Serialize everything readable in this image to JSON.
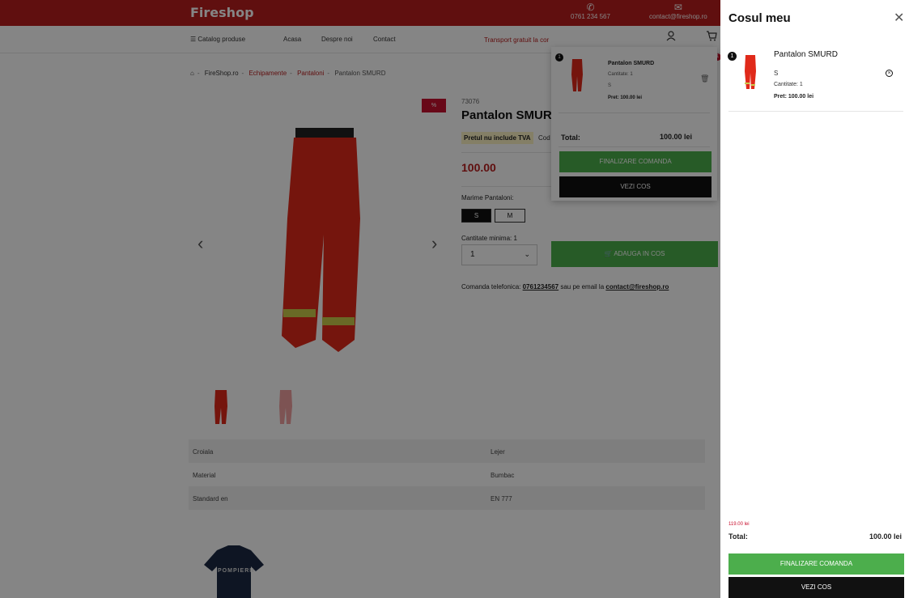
{
  "header": {
    "logo": "Fireshop",
    "phone": "0761 234 567",
    "email": "contact@fireshop.ro",
    "cart_count": "1"
  },
  "nav": {
    "catalog": "Catalog produse",
    "home": "Acasa",
    "about": "Despre noi",
    "contact": "Contact",
    "promo": "Transport gratuit la cor"
  },
  "breadcrumb": {
    "items": [
      "FireShop.ro",
      "Echipamente",
      "Pantaloni",
      "Pantalon SMURD"
    ]
  },
  "product": {
    "sale_badge": "%",
    "sku": "73076",
    "title": "Pantalon SMURD",
    "vat_note": "Pretul nu include TVA",
    "code_label": "Cod",
    "price": "100.00",
    "size_label": "Marime Pantaloni:",
    "sizes": [
      "S",
      "M"
    ],
    "qty_label": "Cantitate minima: 1",
    "qty_value": "1",
    "add_to_cart": "ADAUGA IN COS",
    "order_phone_prefix": "Comanda telefonica: ",
    "order_phone": "0761234567",
    "order_phone_mid": " sau pe email la ",
    "order_email": "contact@fireshop.ro"
  },
  "specs": [
    {
      "name": "Croiala",
      "value": "Lejer"
    },
    {
      "name": "Material",
      "value": "Bumbac"
    },
    {
      "name": "Standard en",
      "value": "EN 777"
    }
  ],
  "related": {
    "label": "POMPIERII"
  },
  "mini_cart": {
    "count": "1",
    "name": "Pantalon SMURD",
    "qty": "Cantitate: 1",
    "size": "S",
    "price": "Pret: 100.00 lei",
    "total_label": "Total:",
    "total_value": "100.00 lei",
    "checkout": "FINALIZARE COMANDA",
    "view_cart": "VEZI COS"
  },
  "drawer": {
    "title": "Cosul meu",
    "item_count": "1",
    "item_name": "Pantalon SMURD",
    "item_size": "S",
    "item_qty": "Cantitate: 1",
    "item_price": "Pret: 100.00 lei",
    "old_total": "119.00 lei",
    "total_label": "Total:",
    "total_value": "100.00 lei",
    "checkout": "FINALIZARE COMANDA",
    "view_cart": "VEZI COS"
  },
  "colors": {
    "brand_red": "#b81e1e",
    "green": "#4cae4c",
    "black": "#111111"
  }
}
